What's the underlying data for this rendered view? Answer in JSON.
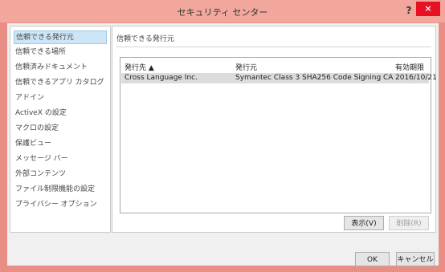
{
  "window": {
    "title": "セキュリティ センター",
    "help_label": "?",
    "close_label": "×"
  },
  "sidebar": {
    "items": [
      {
        "label": "信頼できる発行元",
        "selected": true
      },
      {
        "label": "信頼できる場所"
      },
      {
        "label": "信頼済みドキュメント"
      },
      {
        "label": "信頼できるアプリ カタログ"
      },
      {
        "label": "アドイン"
      },
      {
        "label": "ActiveX の設定"
      },
      {
        "label": "マクロの設定"
      },
      {
        "label": "保護ビュー"
      },
      {
        "label": "メッセージ バー"
      },
      {
        "label": "外部コンテンツ"
      },
      {
        "label": "ファイル制限機能の設定"
      },
      {
        "label": "プライバシー オプション"
      }
    ]
  },
  "main": {
    "section_title": "信頼できる発行元",
    "columns": [
      "発行先 ▲",
      "発行元",
      "有効期限"
    ],
    "rows": [
      {
        "issued_to": "Cross Language Inc.",
        "issued_by": "Symantec Class 3 SHA256 Code Signing CA",
        "expires": "2016/10/21"
      }
    ],
    "view_button": "表示(V)",
    "delete_button": "削除(R)"
  },
  "footer": {
    "ok_button": "OK",
    "cancel_button": "キャンセル"
  },
  "colors": {
    "frame": "#e98e84",
    "selection": "#cde6f7",
    "close": "#e81123"
  }
}
